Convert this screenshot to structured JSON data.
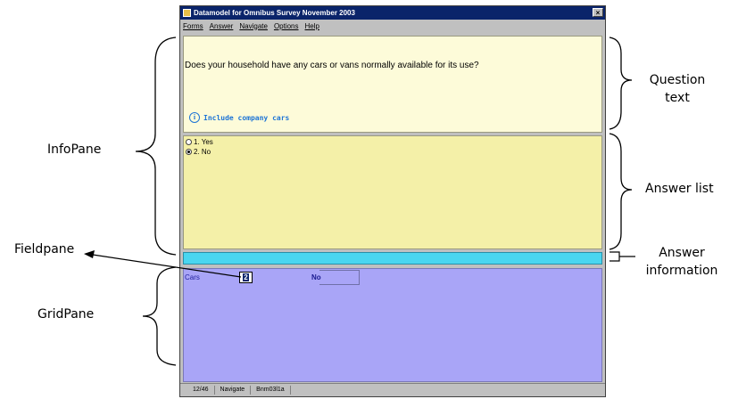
{
  "window": {
    "title": "Datamodel for Omnibus Survey November 2003",
    "close_glyph": "×",
    "menu": [
      "Forms",
      "Answer",
      "Navigate",
      "Options",
      "Help"
    ]
  },
  "question": {
    "text": "Does your household have any cars or vans normally available for its use?",
    "info_glyph": "i",
    "info": "Include company cars"
  },
  "answers": [
    {
      "label": "1. Yes",
      "selected": false
    },
    {
      "label": "2. No",
      "selected": true
    }
  ],
  "field": {
    "label": "Cars",
    "input_value": "2",
    "answer_text": "No"
  },
  "status": [
    "12/46",
    "Navigate",
    "Bnm03l1a"
  ],
  "annotations": {
    "question_text": "Question\ntext",
    "infopane": "InfoPane",
    "answer_list": "Answer list",
    "fieldpane": "Fieldpane",
    "answer_information": "Answer\ninformation",
    "gridpane": "GridPane"
  },
  "colors": {
    "question_pane": "#fdfbd9",
    "answer_pane": "#f4f0a8",
    "answer_info_pane": "#4ad6f0",
    "grid_pane": "#a9a5f7",
    "title_bar": "#0a246a",
    "info_accent": "#1d74d6"
  }
}
